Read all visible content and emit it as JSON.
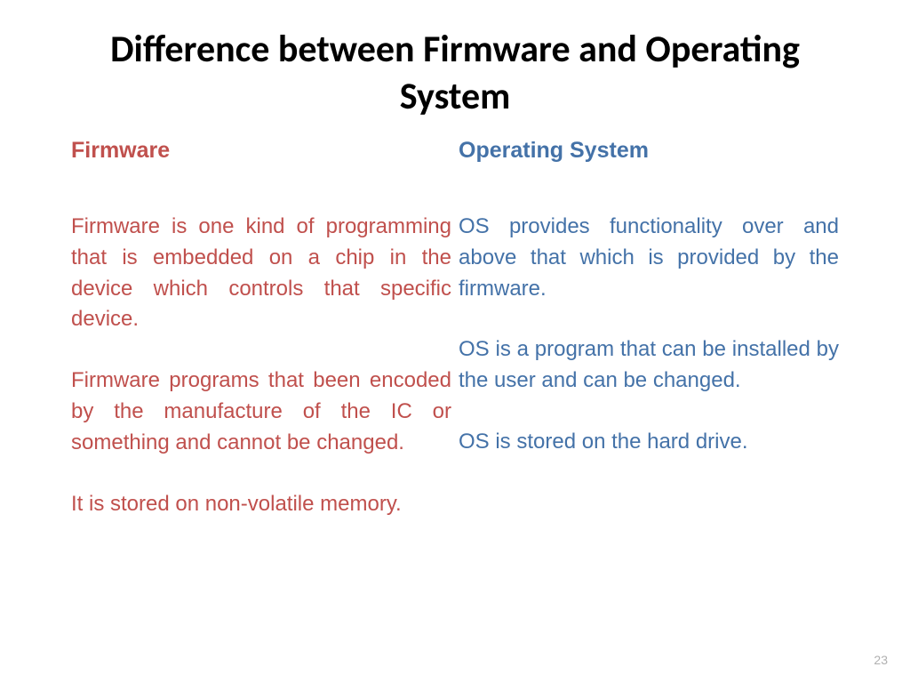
{
  "title": "Difference between Firmware and Operating System",
  "left": {
    "heading": "Firmware",
    "p1": "Firmware is one kind of programming that is embedded on a chip in the device which controls that specific device.",
    "p2": "Firmware programs that been encoded by the manufacture of the IC or something and cannot be changed.",
    "p3": "It is stored on non-volatile memory."
  },
  "right": {
    "heading": "Operating System",
    "p1": "OS provides functionality over and above that which is provided by the firmware.",
    "p2": "OS is a program that can be installed by the user and can be changed.",
    "p3": "OS is stored on the hard drive."
  },
  "page_number": "23"
}
